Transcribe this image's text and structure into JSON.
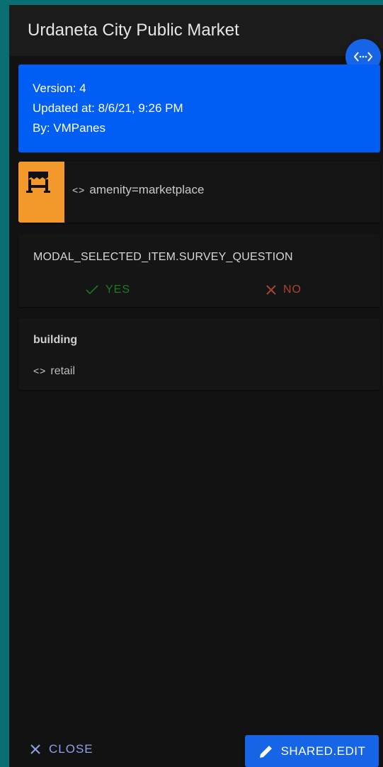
{
  "header": {
    "title": "Urdaneta City Public Market"
  },
  "version_card": {
    "version": "Version: 4",
    "updated": "Updated at: 8/6/21, 9:26 PM",
    "author": "By: VMPanes"
  },
  "tag_card": {
    "tag": "amenity=marketplace",
    "icon": "marketplace-icon"
  },
  "survey": {
    "question": "MODAL_SELECTED_ITEM.SURVEY_QUESTION",
    "yes_label": "YES",
    "no_label": "NO"
  },
  "building": {
    "key": "building",
    "value": "retail"
  },
  "footer": {
    "close_label": "CLOSE",
    "edit_label": "SHARED.EDIT"
  },
  "colors": {
    "accent_blue": "#005ef5",
    "button_blue": "#1565e6",
    "icon_orange": "#f3982b",
    "yes_green": "#1f7a1f",
    "no_red": "#a8462e",
    "background_teal": "#0b6e73"
  }
}
